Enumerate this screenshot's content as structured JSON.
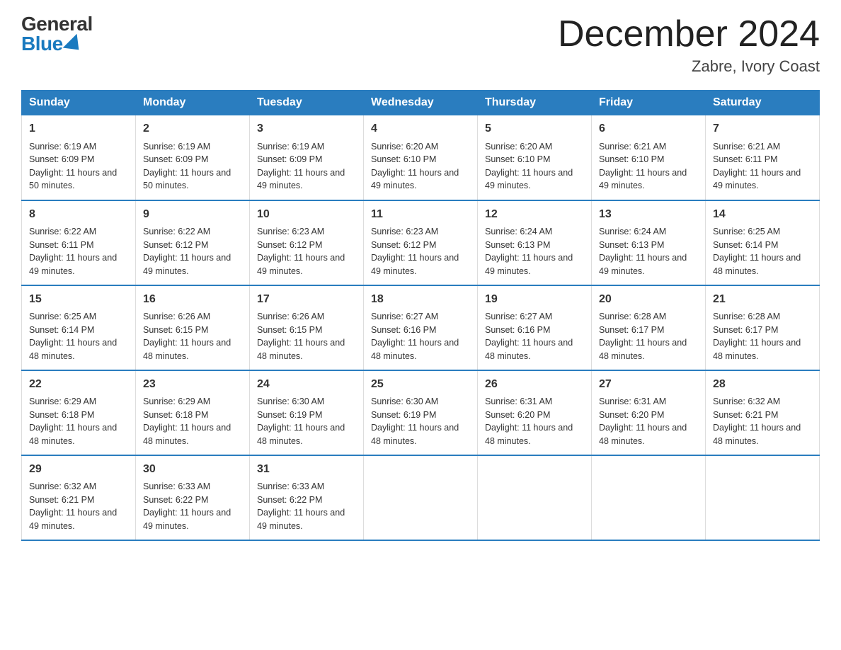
{
  "logo": {
    "general": "General",
    "blue": "Blue"
  },
  "header": {
    "month_year": "December 2024",
    "location": "Zabre, Ivory Coast"
  },
  "weekdays": [
    "Sunday",
    "Monday",
    "Tuesday",
    "Wednesday",
    "Thursday",
    "Friday",
    "Saturday"
  ],
  "weeks": [
    [
      {
        "day": "1",
        "sunrise": "6:19 AM",
        "sunset": "6:09 PM",
        "daylight": "11 hours and 50 minutes."
      },
      {
        "day": "2",
        "sunrise": "6:19 AM",
        "sunset": "6:09 PM",
        "daylight": "11 hours and 50 minutes."
      },
      {
        "day": "3",
        "sunrise": "6:19 AM",
        "sunset": "6:09 PM",
        "daylight": "11 hours and 49 minutes."
      },
      {
        "day": "4",
        "sunrise": "6:20 AM",
        "sunset": "6:10 PM",
        "daylight": "11 hours and 49 minutes."
      },
      {
        "day": "5",
        "sunrise": "6:20 AM",
        "sunset": "6:10 PM",
        "daylight": "11 hours and 49 minutes."
      },
      {
        "day": "6",
        "sunrise": "6:21 AM",
        "sunset": "6:10 PM",
        "daylight": "11 hours and 49 minutes."
      },
      {
        "day": "7",
        "sunrise": "6:21 AM",
        "sunset": "6:11 PM",
        "daylight": "11 hours and 49 minutes."
      }
    ],
    [
      {
        "day": "8",
        "sunrise": "6:22 AM",
        "sunset": "6:11 PM",
        "daylight": "11 hours and 49 minutes."
      },
      {
        "day": "9",
        "sunrise": "6:22 AM",
        "sunset": "6:12 PM",
        "daylight": "11 hours and 49 minutes."
      },
      {
        "day": "10",
        "sunrise": "6:23 AM",
        "sunset": "6:12 PM",
        "daylight": "11 hours and 49 minutes."
      },
      {
        "day": "11",
        "sunrise": "6:23 AM",
        "sunset": "6:12 PM",
        "daylight": "11 hours and 49 minutes."
      },
      {
        "day": "12",
        "sunrise": "6:24 AM",
        "sunset": "6:13 PM",
        "daylight": "11 hours and 49 minutes."
      },
      {
        "day": "13",
        "sunrise": "6:24 AM",
        "sunset": "6:13 PM",
        "daylight": "11 hours and 49 minutes."
      },
      {
        "day": "14",
        "sunrise": "6:25 AM",
        "sunset": "6:14 PM",
        "daylight": "11 hours and 48 minutes."
      }
    ],
    [
      {
        "day": "15",
        "sunrise": "6:25 AM",
        "sunset": "6:14 PM",
        "daylight": "11 hours and 48 minutes."
      },
      {
        "day": "16",
        "sunrise": "6:26 AM",
        "sunset": "6:15 PM",
        "daylight": "11 hours and 48 minutes."
      },
      {
        "day": "17",
        "sunrise": "6:26 AM",
        "sunset": "6:15 PM",
        "daylight": "11 hours and 48 minutes."
      },
      {
        "day": "18",
        "sunrise": "6:27 AM",
        "sunset": "6:16 PM",
        "daylight": "11 hours and 48 minutes."
      },
      {
        "day": "19",
        "sunrise": "6:27 AM",
        "sunset": "6:16 PM",
        "daylight": "11 hours and 48 minutes."
      },
      {
        "day": "20",
        "sunrise": "6:28 AM",
        "sunset": "6:17 PM",
        "daylight": "11 hours and 48 minutes."
      },
      {
        "day": "21",
        "sunrise": "6:28 AM",
        "sunset": "6:17 PM",
        "daylight": "11 hours and 48 minutes."
      }
    ],
    [
      {
        "day": "22",
        "sunrise": "6:29 AM",
        "sunset": "6:18 PM",
        "daylight": "11 hours and 48 minutes."
      },
      {
        "day": "23",
        "sunrise": "6:29 AM",
        "sunset": "6:18 PM",
        "daylight": "11 hours and 48 minutes."
      },
      {
        "day": "24",
        "sunrise": "6:30 AM",
        "sunset": "6:19 PM",
        "daylight": "11 hours and 48 minutes."
      },
      {
        "day": "25",
        "sunrise": "6:30 AM",
        "sunset": "6:19 PM",
        "daylight": "11 hours and 48 minutes."
      },
      {
        "day": "26",
        "sunrise": "6:31 AM",
        "sunset": "6:20 PM",
        "daylight": "11 hours and 48 minutes."
      },
      {
        "day": "27",
        "sunrise": "6:31 AM",
        "sunset": "6:20 PM",
        "daylight": "11 hours and 48 minutes."
      },
      {
        "day": "28",
        "sunrise": "6:32 AM",
        "sunset": "6:21 PM",
        "daylight": "11 hours and 48 minutes."
      }
    ],
    [
      {
        "day": "29",
        "sunrise": "6:32 AM",
        "sunset": "6:21 PM",
        "daylight": "11 hours and 49 minutes."
      },
      {
        "day": "30",
        "sunrise": "6:33 AM",
        "sunset": "6:22 PM",
        "daylight": "11 hours and 49 minutes."
      },
      {
        "day": "31",
        "sunrise": "6:33 AM",
        "sunset": "6:22 PM",
        "daylight": "11 hours and 49 minutes."
      },
      {
        "day": "",
        "sunrise": "",
        "sunset": "",
        "daylight": ""
      },
      {
        "day": "",
        "sunrise": "",
        "sunset": "",
        "daylight": ""
      },
      {
        "day": "",
        "sunrise": "",
        "sunset": "",
        "daylight": ""
      },
      {
        "day": "",
        "sunrise": "",
        "sunset": "",
        "daylight": ""
      }
    ]
  ]
}
